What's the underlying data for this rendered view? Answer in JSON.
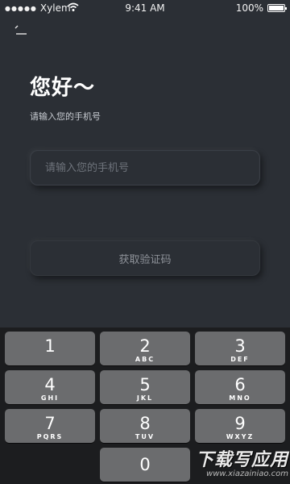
{
  "status_bar": {
    "carrier": "Xylem",
    "time": "9:41 AM",
    "battery": "100%"
  },
  "header": {
    "greeting": "您好～",
    "subtitle": "请输入您的手机号"
  },
  "form": {
    "phone_placeholder": "请输入您的手机号",
    "phone_value": "",
    "verify_button_label": "获取验证码"
  },
  "keypad": {
    "keys": [
      {
        "digit": "1",
        "letters": ""
      },
      {
        "digit": "2",
        "letters": "ABC"
      },
      {
        "digit": "3",
        "letters": "DEF"
      },
      {
        "digit": "4",
        "letters": "GHI"
      },
      {
        "digit": "5",
        "letters": "JKL"
      },
      {
        "digit": "6",
        "letters": "MNO"
      },
      {
        "digit": "7",
        "letters": "PQRS"
      },
      {
        "digit": "8",
        "letters": "TUV"
      },
      {
        "digit": "9",
        "letters": "WXYZ"
      },
      {
        "digit": "0",
        "letters": ""
      }
    ]
  },
  "watermark": {
    "title": "下载写应用",
    "url": "www.xiazainiao.com"
  },
  "colors": {
    "background": "#2b2f35",
    "keypad_background": "#1c1d1f",
    "key": "#6b6c6e"
  }
}
